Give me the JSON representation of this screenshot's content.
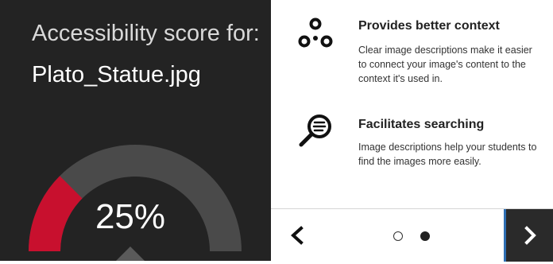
{
  "score_panel": {
    "heading": "Accessibility score for:",
    "file_name": "Plato_Statue.jpg",
    "score_text": "25%",
    "score_fraction": 0.25,
    "colors": {
      "track": "#4a4a4a",
      "fill": "#c8102e",
      "background": "#232323"
    }
  },
  "features": [
    {
      "icon": "context-nodes-icon",
      "title": "Provides better context",
      "description": "Clear image descriptions make it easier to connect your image's content to the context it's used in."
    },
    {
      "icon": "search-document-icon",
      "title": "Facilitates searching",
      "description": "Image descriptions help your students to find the images more easily."
    }
  ],
  "navigation": {
    "prev_icon": "chevron-left-icon",
    "next_icon": "chevron-right-icon",
    "dot_count": 2,
    "active_dot": 2,
    "accent_color": "#2f6fb3"
  }
}
